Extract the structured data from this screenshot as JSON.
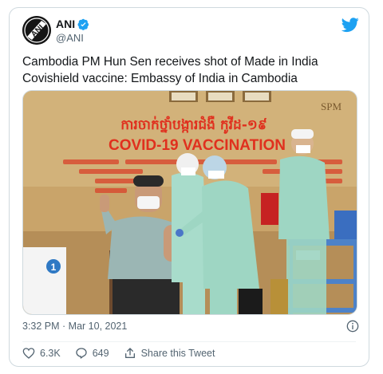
{
  "author": {
    "display_name": "ANI",
    "handle": "@ANI",
    "avatar_text": "ANI",
    "verified_icon": "verified-badge-icon"
  },
  "tweet": {
    "text": "Cambodia PM Hun Sen receives shot of Made in India Covishield vaccine: Embassy of India in Cambodia",
    "timestamp": "3:32 PM · Mar 10, 2021"
  },
  "media": {
    "banner_title_khmer": "ការចាក់ថ្នាំបង្ការជំងឺ កូវីដ-១៩",
    "banner_title_english": "COVID-19 VACCINATION",
    "watermark": "SPM",
    "number_sign": "1",
    "colors": {
      "wall": "#c9a66b",
      "ppe": "#9ed6c3",
      "cabinet": "#4d82c8",
      "banner_text": "#e0301e"
    }
  },
  "actions": {
    "likes": "6.3K",
    "replies": "649",
    "share_label": "Share this Tweet"
  },
  "colors": {
    "brand": "#1da1f2",
    "text": "#14171a",
    "muted": "#536471"
  }
}
